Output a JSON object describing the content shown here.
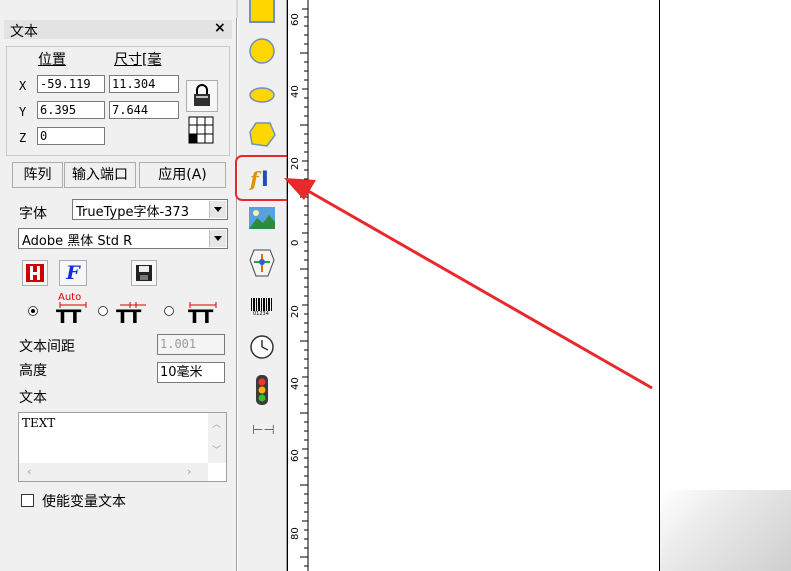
{
  "panel": {
    "title": "文本",
    "close_label": "×",
    "position_label": "位置",
    "size_label": "尺寸[毫",
    "x_label": "X",
    "y_label": "Y",
    "z_label": "Z",
    "x_value": "-59.119",
    "y_value": "6.395",
    "z_value": "0",
    "width_value": "11.304",
    "height_value": "7.644",
    "array_button": "阵列",
    "input_port_button": "输入端口",
    "apply_button": "应用(A)",
    "font_label": "字体",
    "font_type_value": "TrueType字体-373",
    "font_name_value": "Adobe 黑体 Std R",
    "auto_label": "Auto",
    "tt_glyph": "TT",
    "spacing_label": "文本间距",
    "spacing_value": "1.001",
    "height_label": "高度",
    "text_height_value": "10毫米",
    "text_label": "文本",
    "text_value": "TEXT",
    "variable_text_label": "使能变量文本"
  },
  "toolbar": {
    "tools": [
      "rectangle-tool",
      "circle-tool",
      "ellipse-tool",
      "polygon-tool",
      "text-tool",
      "bitmap-tool",
      "vector-file-tool",
      "barcode-tool",
      "delay-tool",
      "input-port-tool",
      "output-port-tool"
    ],
    "barcode_digits": "01234",
    "output_glyph": "⊢⊣"
  },
  "ruler": {
    "labels": [
      "60",
      "40",
      "20",
      "0",
      "20",
      "40",
      "60",
      "80"
    ]
  },
  "colors": {
    "highlight": "#e8282a",
    "arrow": "#e8282a",
    "panel_bg": "#f0f0f0",
    "tool_yellow": "#ffd700"
  }
}
